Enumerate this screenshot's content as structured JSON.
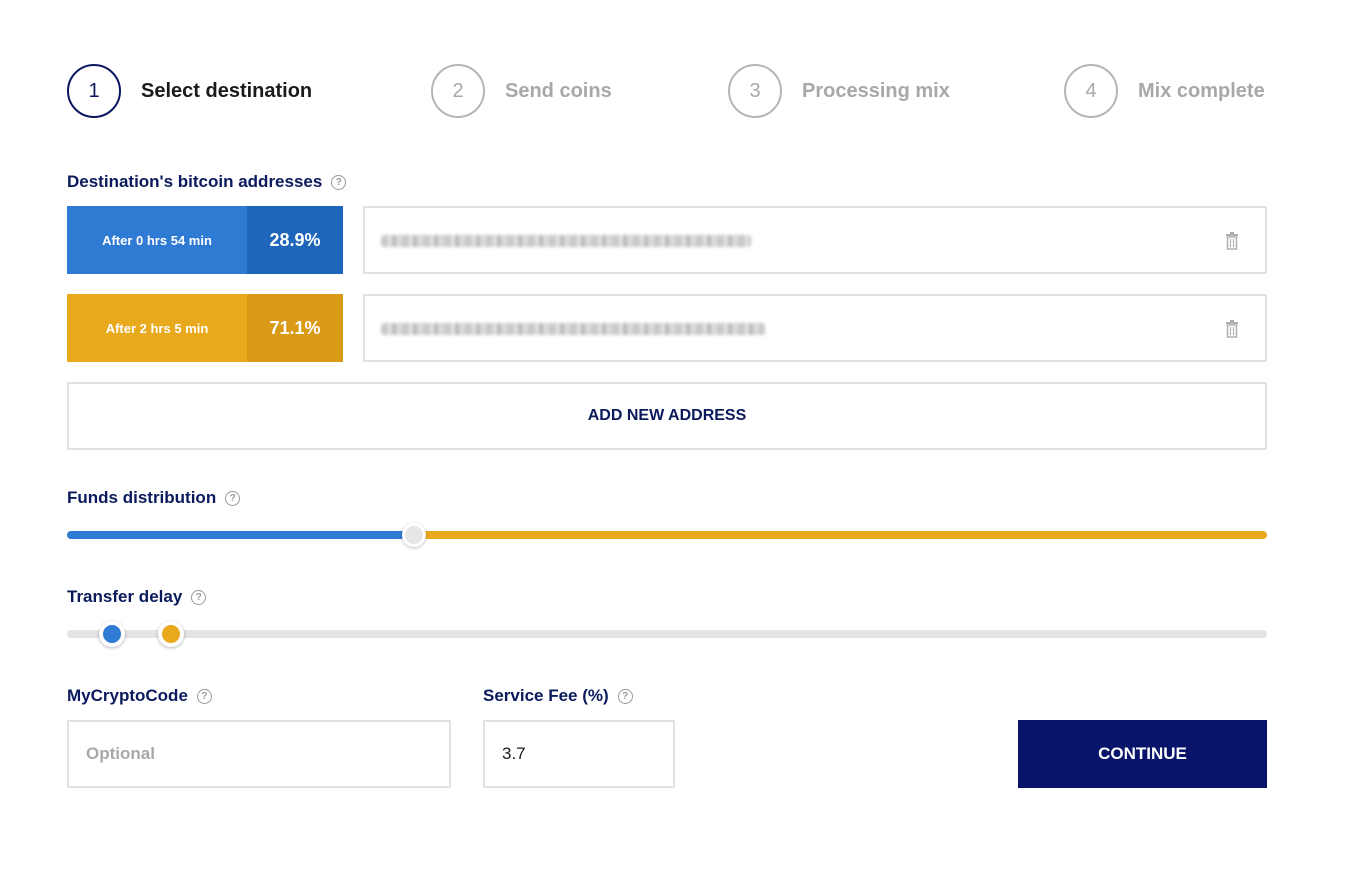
{
  "steps": [
    {
      "number": "1",
      "label": "Select destination",
      "active": true
    },
    {
      "number": "2",
      "label": "Send coins",
      "active": false
    },
    {
      "number": "3",
      "label": "Processing mix",
      "active": false
    },
    {
      "number": "4",
      "label": "Mix complete",
      "active": false
    }
  ],
  "destinations": {
    "label": "Destination's bitcoin addresses",
    "help_icon": "?",
    "addresses": [
      {
        "delay_label": "After 0 hrs 54 min",
        "percent_label": "28.9%",
        "color": "#2f7bd3",
        "address": ""
      },
      {
        "delay_label": "After 2 hrs 5 min",
        "percent_label": "71.1%",
        "color": "#e9a91d",
        "address": ""
      }
    ],
    "add_label": "ADD NEW ADDRESS"
  },
  "distribution": {
    "label": "Funds distribution",
    "help_icon": "?",
    "value_percent": 28.9
  },
  "delay": {
    "label": "Transfer delay",
    "help_icon": "?",
    "thumbs": [
      {
        "color": "#2f7bd3",
        "position_fraction": 0.0375
      },
      {
        "color": "#e9a91d",
        "position_fraction": 0.0867
      }
    ]
  },
  "code": {
    "label": "MyCryptoCode",
    "help_icon": "?",
    "placeholder": "Optional",
    "value": ""
  },
  "fee": {
    "label": "Service Fee (%)",
    "help_icon": "?",
    "value": "3.7"
  },
  "continue_label": "CONTINUE",
  "colors": {
    "navy": "#07146a",
    "blue": "#2f7bd3",
    "gold": "#e9a91d"
  }
}
